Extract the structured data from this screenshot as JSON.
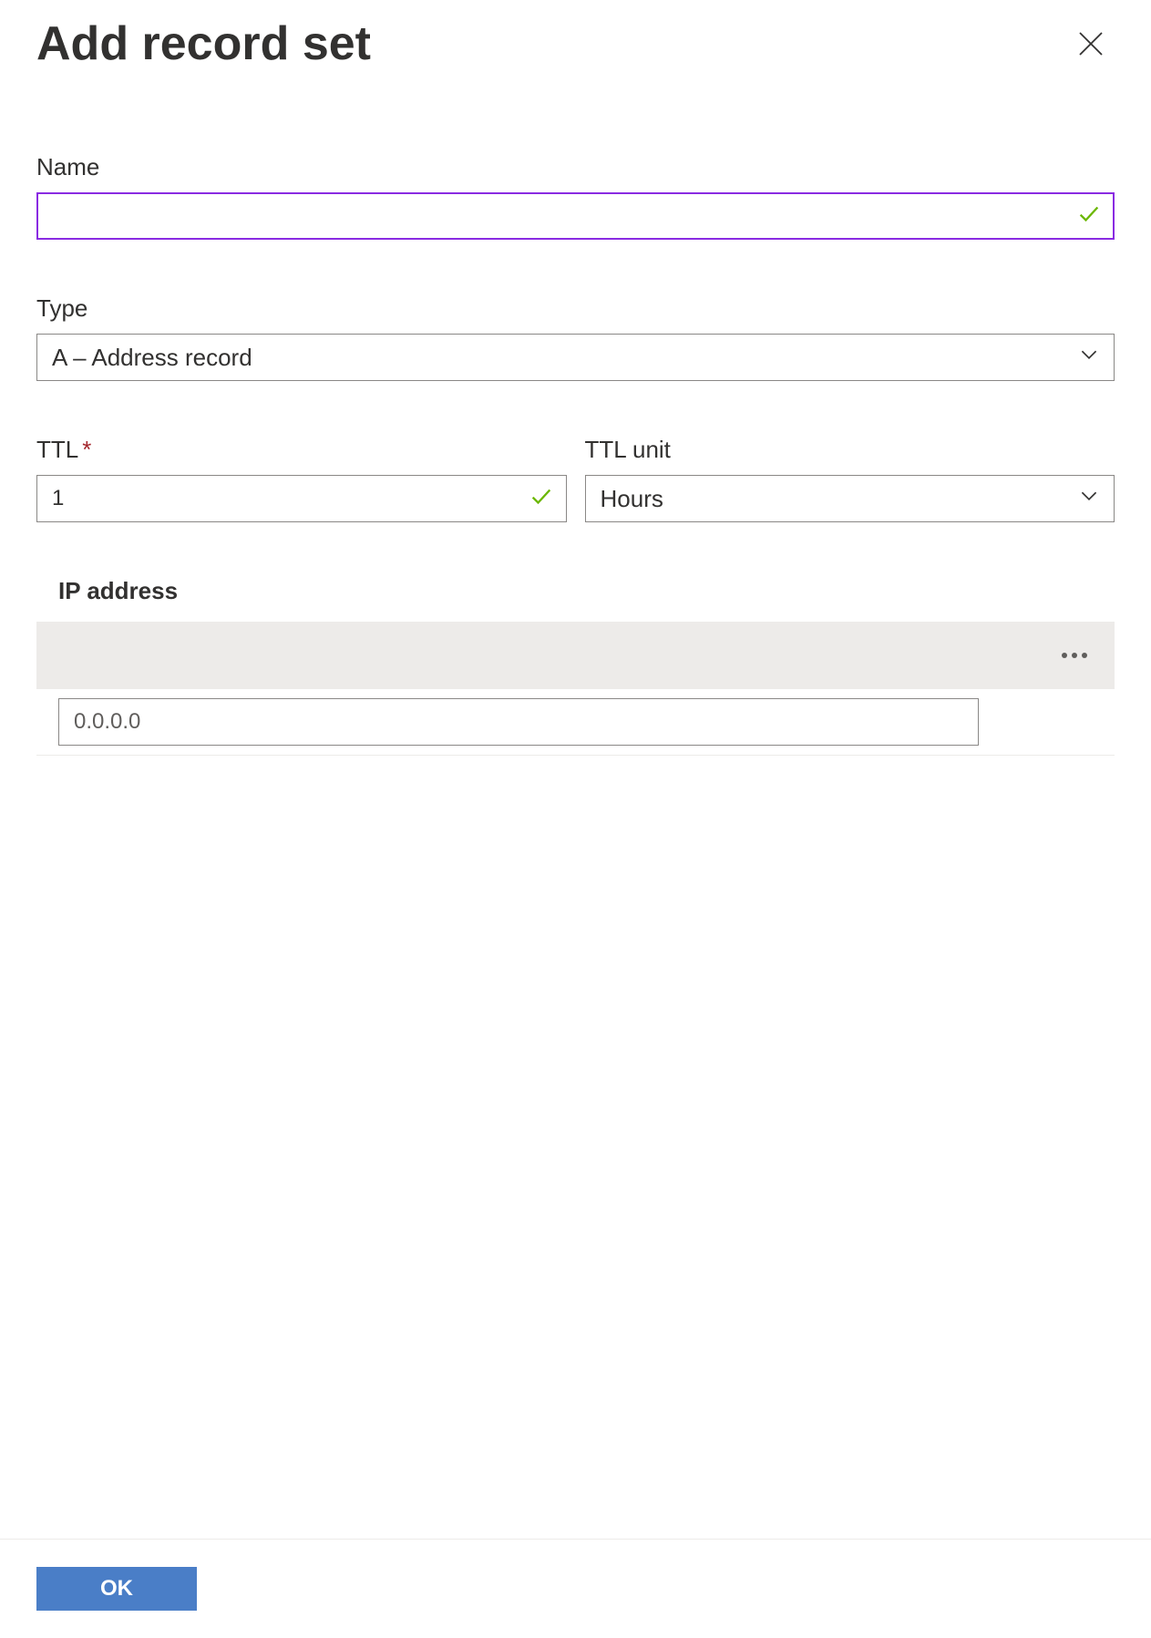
{
  "header": {
    "title": "Add record set"
  },
  "fields": {
    "name": {
      "label": "Name",
      "value": ""
    },
    "type": {
      "label": "Type",
      "selected": "A – Address record"
    },
    "ttl": {
      "label": "TTL",
      "value": "1",
      "required": true
    },
    "ttl_unit": {
      "label": "TTL unit",
      "selected": "Hours"
    },
    "ip_address": {
      "label": "IP address",
      "placeholder": "0.0.0.0"
    }
  },
  "footer": {
    "ok_label": "OK"
  }
}
